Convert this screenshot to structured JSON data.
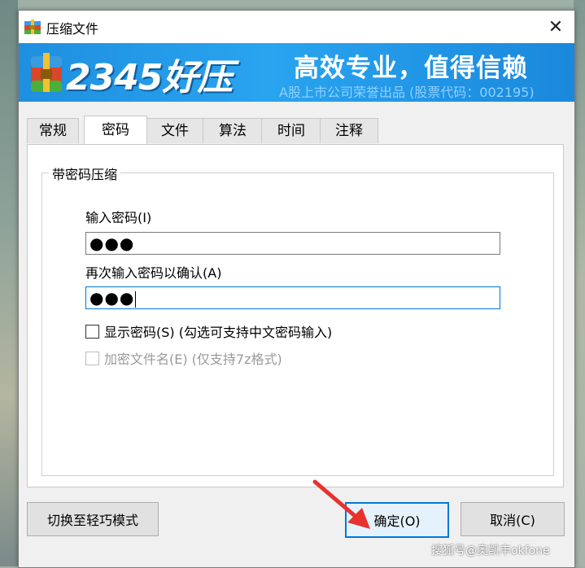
{
  "window": {
    "title": "压缩文件",
    "close_glyph": "✕"
  },
  "banner": {
    "brand": "2345好压",
    "slogan": "高效专业，值得信赖",
    "subtitle": "A股上市公司荣誉出品 (股票代码：002195)",
    "background_color": "#1f8fe0"
  },
  "tabs": [
    {
      "label": "常规",
      "active": false
    },
    {
      "label": "密码",
      "active": true
    },
    {
      "label": "文件",
      "active": false
    },
    {
      "label": "算法",
      "active": false
    },
    {
      "label": "时间",
      "active": false
    },
    {
      "label": "注释",
      "active": false
    }
  ],
  "password_group": {
    "legend": "带密码压缩",
    "password_label": "输入密码(I)",
    "password_value": "●●●",
    "confirm_label": "再次输入密码以确认(A)",
    "confirm_value": "●●●",
    "show_password": {
      "label": "显示密码(S) (勾选可支持中文密码输入)",
      "checked": false
    },
    "encrypt_filenames": {
      "label": "加密文件名(E) (仅支持7z格式)",
      "checked": false,
      "disabled": true
    }
  },
  "buttons": {
    "switch_mode": "切换至轻巧模式",
    "ok": "确定(O)",
    "cancel": "取消(C)"
  },
  "watermark": "搜狐号@奥凯丰okfone",
  "colors": {
    "accent": "#0078d7",
    "arrow": "#e8322d"
  }
}
